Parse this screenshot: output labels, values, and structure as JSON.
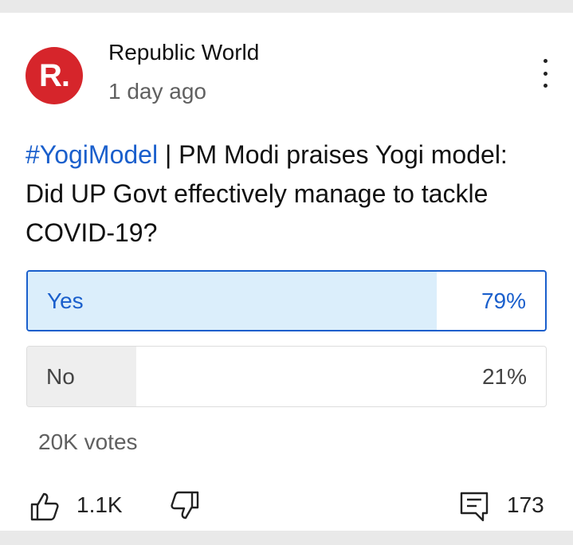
{
  "post": {
    "channel_name": "Republic World",
    "avatar_letter": "R.",
    "time_ago": "1 day ago",
    "hashtag": "#YogiModel",
    "text": " | PM Modi praises Yogi model: Did UP Govt effectively manage to tackle COVID-19?"
  },
  "poll": {
    "options": [
      {
        "label": "Yes",
        "percent_label": "79%",
        "percent": 79,
        "selected": true
      },
      {
        "label": "No",
        "percent_label": "21%",
        "percent": 21,
        "selected": false
      }
    ],
    "votes": "20K votes"
  },
  "actions": {
    "likes": "1.1K",
    "comments": "173"
  },
  "colors": {
    "accent": "#1a5fcc",
    "avatar_bg": "#d6252b",
    "selected_fill": "#dbeefb",
    "unselected_fill": "#eeeeee"
  },
  "icons": [
    "more-vert-icon",
    "thumb-up-icon",
    "thumb-down-icon",
    "comment-icon"
  ]
}
